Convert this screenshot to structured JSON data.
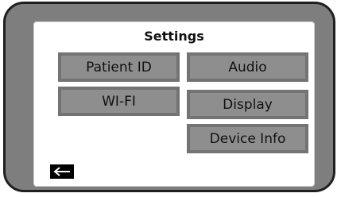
{
  "screen": {
    "title": "Settings"
  },
  "menu": {
    "patient_id": "Patient ID",
    "audio": "Audio",
    "wifi": "WI-FI",
    "display": "Display",
    "device_info": "Device Info"
  },
  "footer": {
    "back_icon": "back-arrow-icon"
  }
}
